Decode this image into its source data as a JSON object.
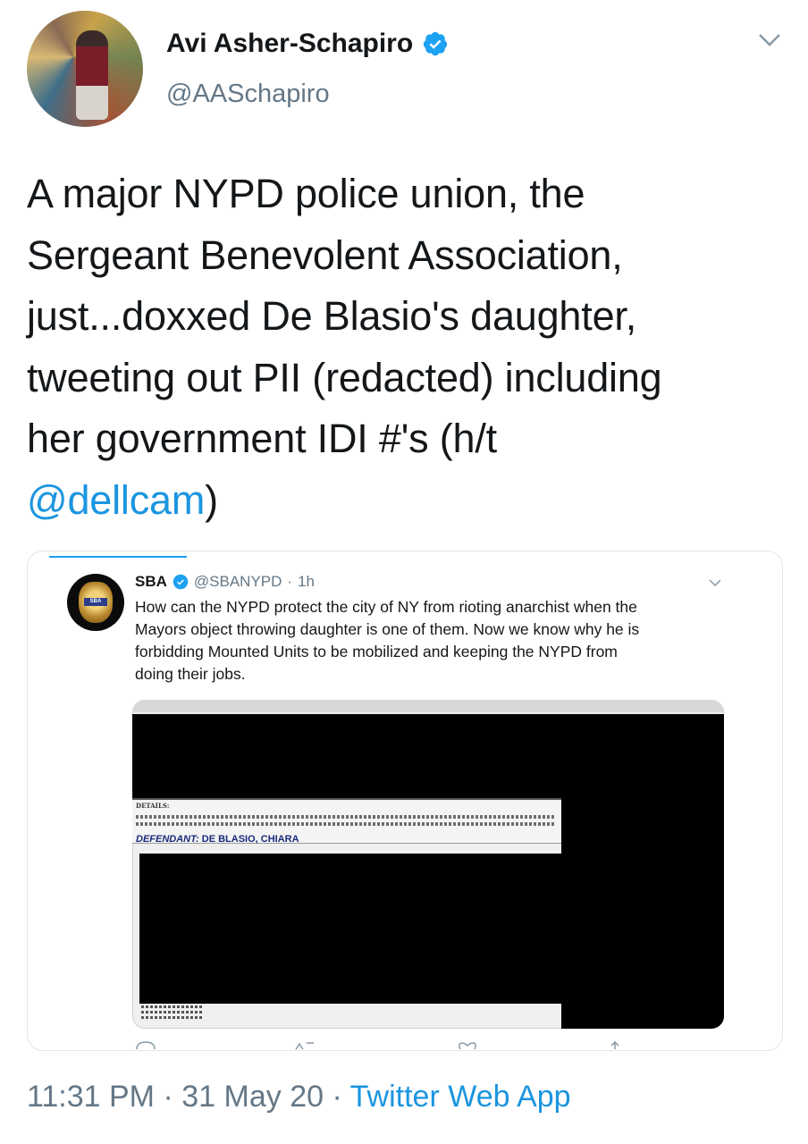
{
  "author": {
    "name": "Avi Asher-Schapiro",
    "handle": "@AASchapiro"
  },
  "tweet": {
    "lines": [
      "A major NYPD police union, the",
      "Sergeant Benevolent Association,",
      "just...doxxed De Blasio's daughter,",
      "tweeting out PII (redacted) including",
      "her government IDI #'s (h/t"
    ],
    "mention": "@dellcam",
    "closing": ")"
  },
  "quoted": {
    "name": "SBA",
    "handle": "@SBANYPD",
    "separator": "·",
    "time": "1h",
    "avatar_badge": "SBA",
    "body_lines": [
      "How can the NYPD protect the city of NY from rioting anarchist when the",
      "Mayors object throwing daughter is one of them. Now we know why he is",
      "forbidding Mounted Units to be mobilized and keeping the NYPD from",
      "doing their jobs."
    ],
    "document": {
      "details_label": "DETAILS:",
      "defendant_label": "DEFENDANT:",
      "defendant_value": "DE BLASIO, CHIARA"
    }
  },
  "meta": {
    "time": "11:31 PM",
    "dot": "·",
    "date": "31 May 20",
    "source": "Twitter Web App"
  },
  "colors": {
    "link": "#1b95e0",
    "secondary": "#657786",
    "verified": "#1da1f2"
  }
}
